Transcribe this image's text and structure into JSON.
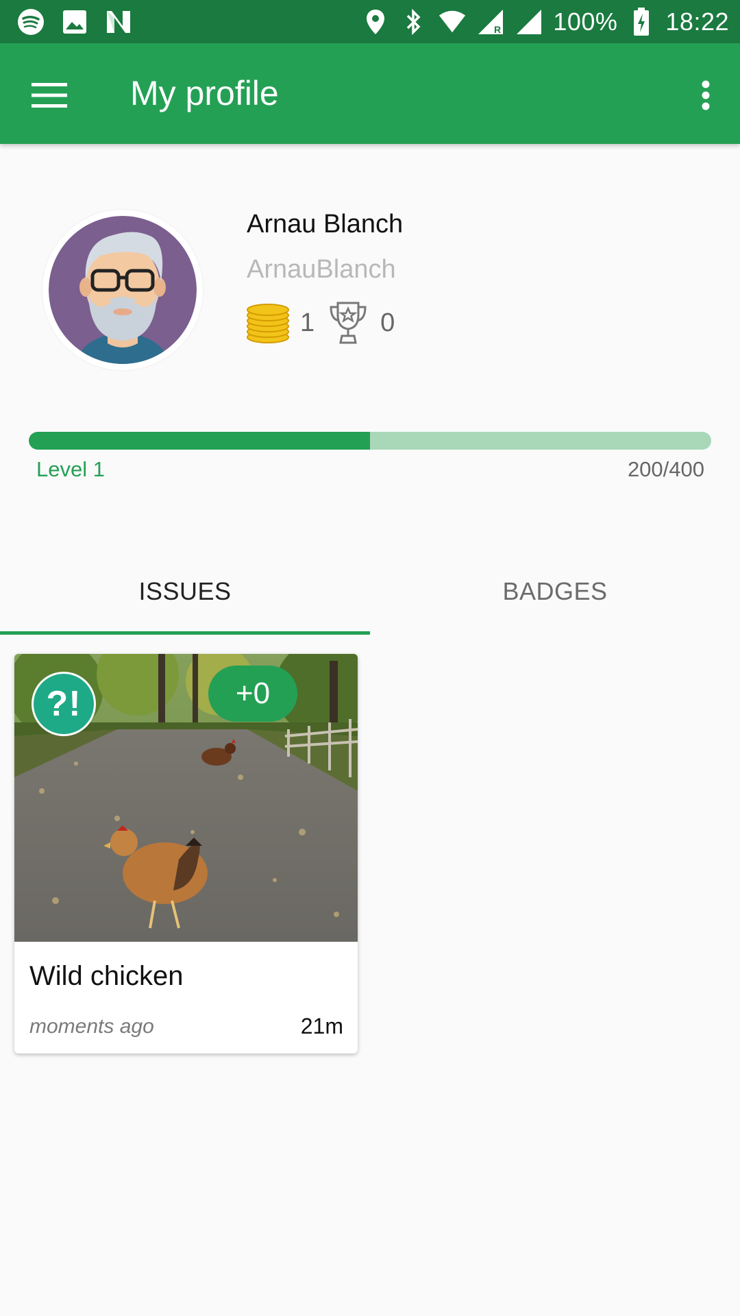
{
  "status_bar": {
    "battery": "100%",
    "time": "18:22",
    "icons": [
      "spotify-icon",
      "gallery-icon",
      "n-icon",
      "location-icon",
      "bluetooth-icon",
      "wifi-icon",
      "signal-r-icon",
      "signal-icon",
      "battery-charging-icon"
    ]
  },
  "app_bar": {
    "title": "My profile",
    "menu_icon": "hamburger-menu-icon",
    "overflow_icon": "more-vert-icon"
  },
  "profile": {
    "name": "Arnau Blanch",
    "username": "ArnauBlanch",
    "coins": "1",
    "trophies": "0"
  },
  "progress": {
    "level_label": "Level 1",
    "xp_label": "200/400",
    "fraction": 0.5
  },
  "tabs": [
    {
      "label": "ISSUES",
      "active": true
    },
    {
      "label": "BADGES",
      "active": false
    }
  ],
  "issues": [
    {
      "title": "Wild chicken",
      "time": "moments ago",
      "distance": "21m",
      "score": "+0",
      "type_badge": "?!"
    }
  ],
  "colors": {
    "primary": "#24a055",
    "status_bar": "#1a7a3f",
    "progress_track": "#a8d8b8",
    "badge": "#1eaa86"
  }
}
